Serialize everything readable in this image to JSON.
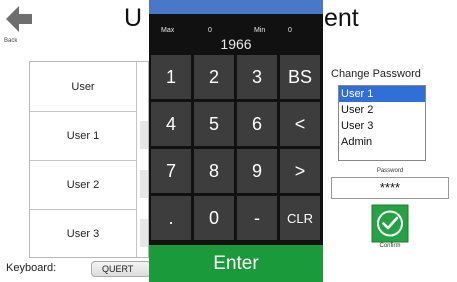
{
  "header": {
    "back_label": "Back",
    "title_left": "U",
    "title_right": "ent"
  },
  "users_table": {
    "rows": [
      "User",
      "User 1",
      "User 2",
      "User 3"
    ]
  },
  "keyboard": {
    "label": "Keyboard:",
    "selected": "QUERT"
  },
  "keypad": {
    "max_label": "Max",
    "max_value": "0",
    "min_label": "Min",
    "min_value": "0",
    "value": "1966",
    "keys": [
      "1",
      "2",
      "3",
      "BS",
      "4",
      "5",
      "6",
      "<",
      "7",
      "8",
      "9",
      ">",
      ".",
      "0",
      "-",
      "CLR"
    ],
    "enter_label": "Enter"
  },
  "change_password": {
    "title": "Change Password",
    "users": [
      "User 1",
      "User 2",
      "User 3",
      "Admin"
    ],
    "selected_user": "User 1",
    "password_label": "Password",
    "password_value": "****",
    "confirm_label": "Confirm"
  },
  "colors": {
    "keypad_bg": "#111111",
    "key_bg": "#3d3d3d",
    "enter_green": "#1b9a3c",
    "accent_blue": "#2f6fd6",
    "confirm_green": "#25a244"
  }
}
